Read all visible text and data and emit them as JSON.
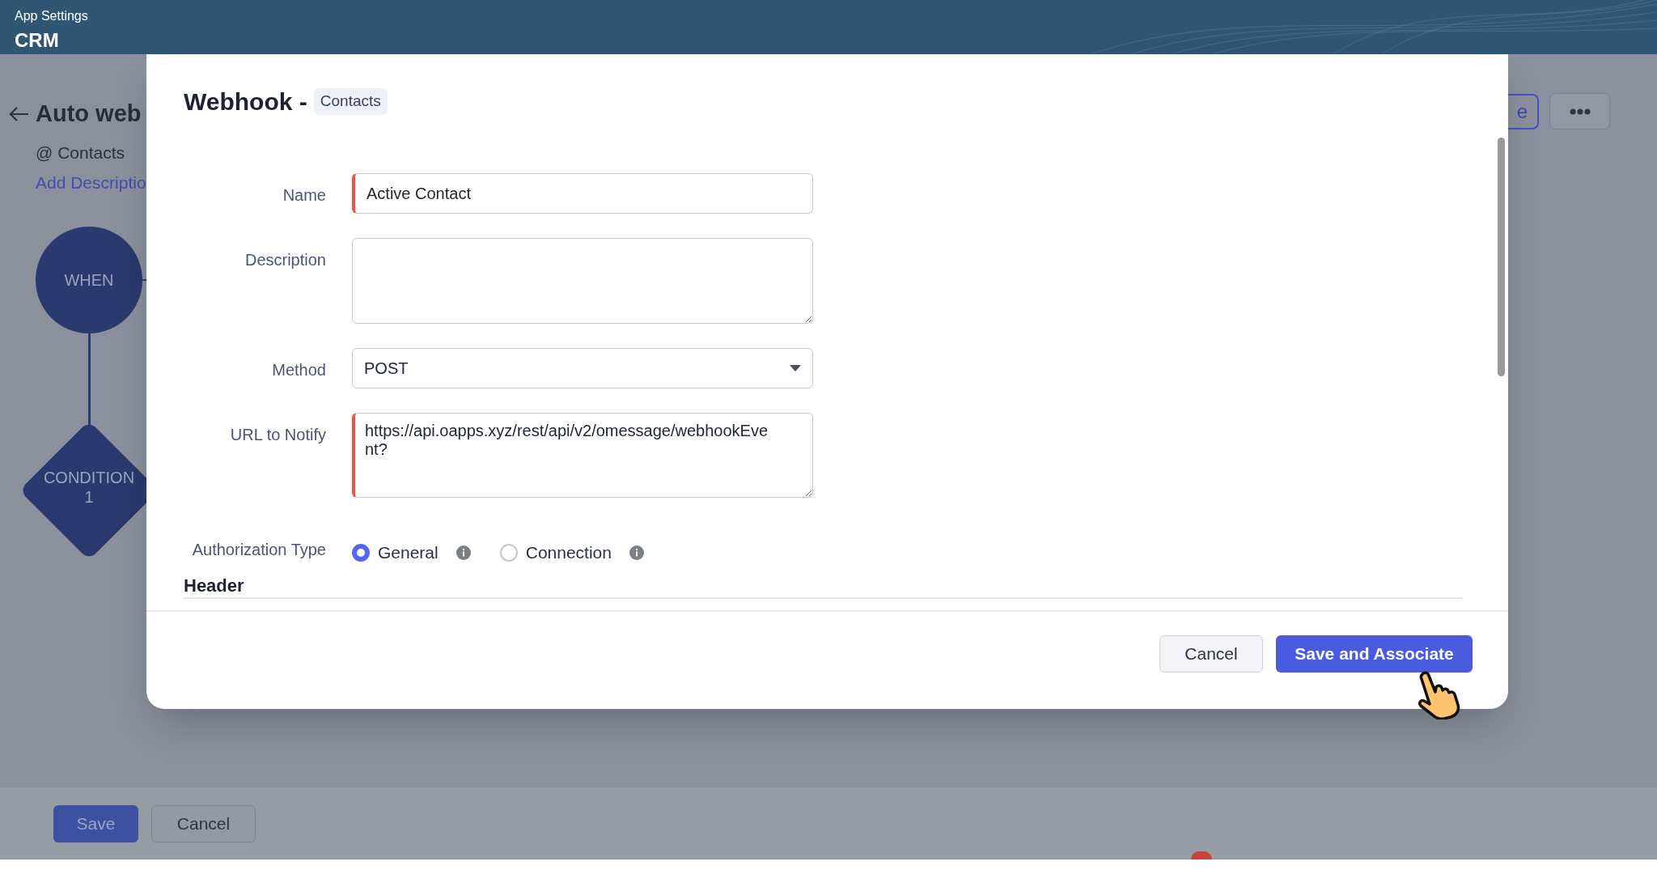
{
  "app_header": {
    "subtitle": "App Settings",
    "title": "CRM"
  },
  "background_page": {
    "title": "Auto web",
    "module": "@ Contacts",
    "add_description_link": "Add Descriptio",
    "flow_nodes": [
      {
        "kind": "circle",
        "label": "WHEN"
      },
      {
        "kind": "diamond",
        "label": "CONDITION 1"
      }
    ],
    "top_buttons": [
      {
        "kind": "outline",
        "label": "e"
      },
      {
        "kind": "more"
      }
    ],
    "footer_buttons": [
      {
        "kind": "primary",
        "label": "Save"
      },
      {
        "kind": "secondary",
        "label": "Cancel"
      }
    ]
  },
  "modal": {
    "title": "Webhook -",
    "module_badge": "Contacts",
    "fields": [
      {
        "kind": "text",
        "label": "Name",
        "value": "Active Contact",
        "required": true
      },
      {
        "kind": "textarea",
        "label": "Description",
        "required": false
      },
      {
        "kind": "select",
        "label": "Method",
        "value": "POST",
        "required": false
      },
      {
        "kind": "url",
        "label": "URL to Notify",
        "value": "https://api.oapps.xyz/rest/api/v2/omessage/webhookEvent?",
        "required": true
      }
    ],
    "authorization": {
      "label": "Authorization Type",
      "options": [
        {
          "label": "General",
          "selected": true
        },
        {
          "label": "Connection",
          "selected": false
        }
      ]
    },
    "section_heading": "Header",
    "buttons": [
      {
        "kind": "secondary",
        "label": "Cancel"
      },
      {
        "kind": "primary",
        "label": "Save and Associate"
      }
    ]
  }
}
